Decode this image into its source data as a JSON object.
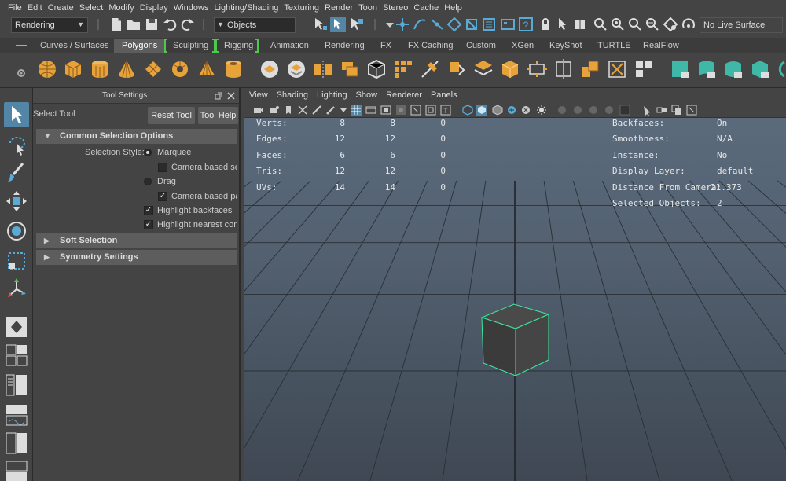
{
  "menubar": {
    "items": [
      "File",
      "Edit",
      "Create",
      "Select",
      "Modify",
      "Display",
      "Windows",
      "Lighting/Shading",
      "Texturing",
      "Render",
      "Toon",
      "Stereo",
      "Cache",
      "Help"
    ]
  },
  "statusline": {
    "menuset": "Rendering",
    "selection_mode": "Objects",
    "live_surface": "No Live Surface"
  },
  "shelf": {
    "tabs": [
      "Curves / Surfaces",
      "Polygons",
      "Sculpting",
      "Rigging",
      "Animation",
      "Rendering",
      "FX",
      "FX Caching",
      "Custom",
      "XGen",
      "KeyShot",
      "TURTLE",
      "RealFlow"
    ],
    "active_tab": "Polygons"
  },
  "tool_settings": {
    "title": "Tool Settings",
    "tool_name": "Select Tool",
    "reset_label": "Reset Tool",
    "help_label": "Tool Help",
    "sections": {
      "common": "Common Selection Options",
      "soft": "Soft Selection",
      "symmetry": "Symmetry Settings"
    },
    "selection_style_label": "Selection Style:",
    "marquee_label": "Marquee",
    "camera_based_sel_label": "Camera based sel",
    "drag_label": "Drag",
    "camera_based_paint_label": "Camera based pai",
    "highlight_backfaces_label": "Highlight backfaces",
    "highlight_nearest_label": "Highlight nearest com",
    "marquee_selected": true,
    "camera_based_sel_checked": false,
    "camera_based_paint_checked": true,
    "highlight_backfaces_checked": true,
    "highlight_nearest_checked": true
  },
  "viewport": {
    "menu": [
      "View",
      "Shading",
      "Lighting",
      "Show",
      "Renderer",
      "Panels"
    ],
    "hud_stats": [
      {
        "label": "Verts:",
        "v1": "8",
        "v2": "8",
        "v3": "0"
      },
      {
        "label": "Edges:",
        "v1": "12",
        "v2": "12",
        "v3": "0"
      },
      {
        "label": "Faces:",
        "v1": "6",
        "v2": "6",
        "v3": "0"
      },
      {
        "label": "Tris:",
        "v1": "12",
        "v2": "12",
        "v3": "0"
      },
      {
        "label": "UVs:",
        "v1": "14",
        "v2": "14",
        "v3": "0"
      }
    ],
    "hud_info": [
      {
        "label": "Backfaces:",
        "value": "On"
      },
      {
        "label": "Smoothness:",
        "value": "N/A"
      },
      {
        "label": "Instance:",
        "value": "No"
      },
      {
        "label": "Display Layer:",
        "value": "default"
      },
      {
        "label": "Distance From Camera:",
        "value": "21.373"
      },
      {
        "label": "Selected Objects:",
        "value": "2"
      }
    ]
  },
  "colors": {
    "selection_highlight": "#5285a6",
    "cube_wireframe": "#3ee8a0",
    "shelf_bracket": "#4ec94e",
    "icon_orange": "#e8a23a",
    "icon_teal": "#3fb8a8"
  }
}
